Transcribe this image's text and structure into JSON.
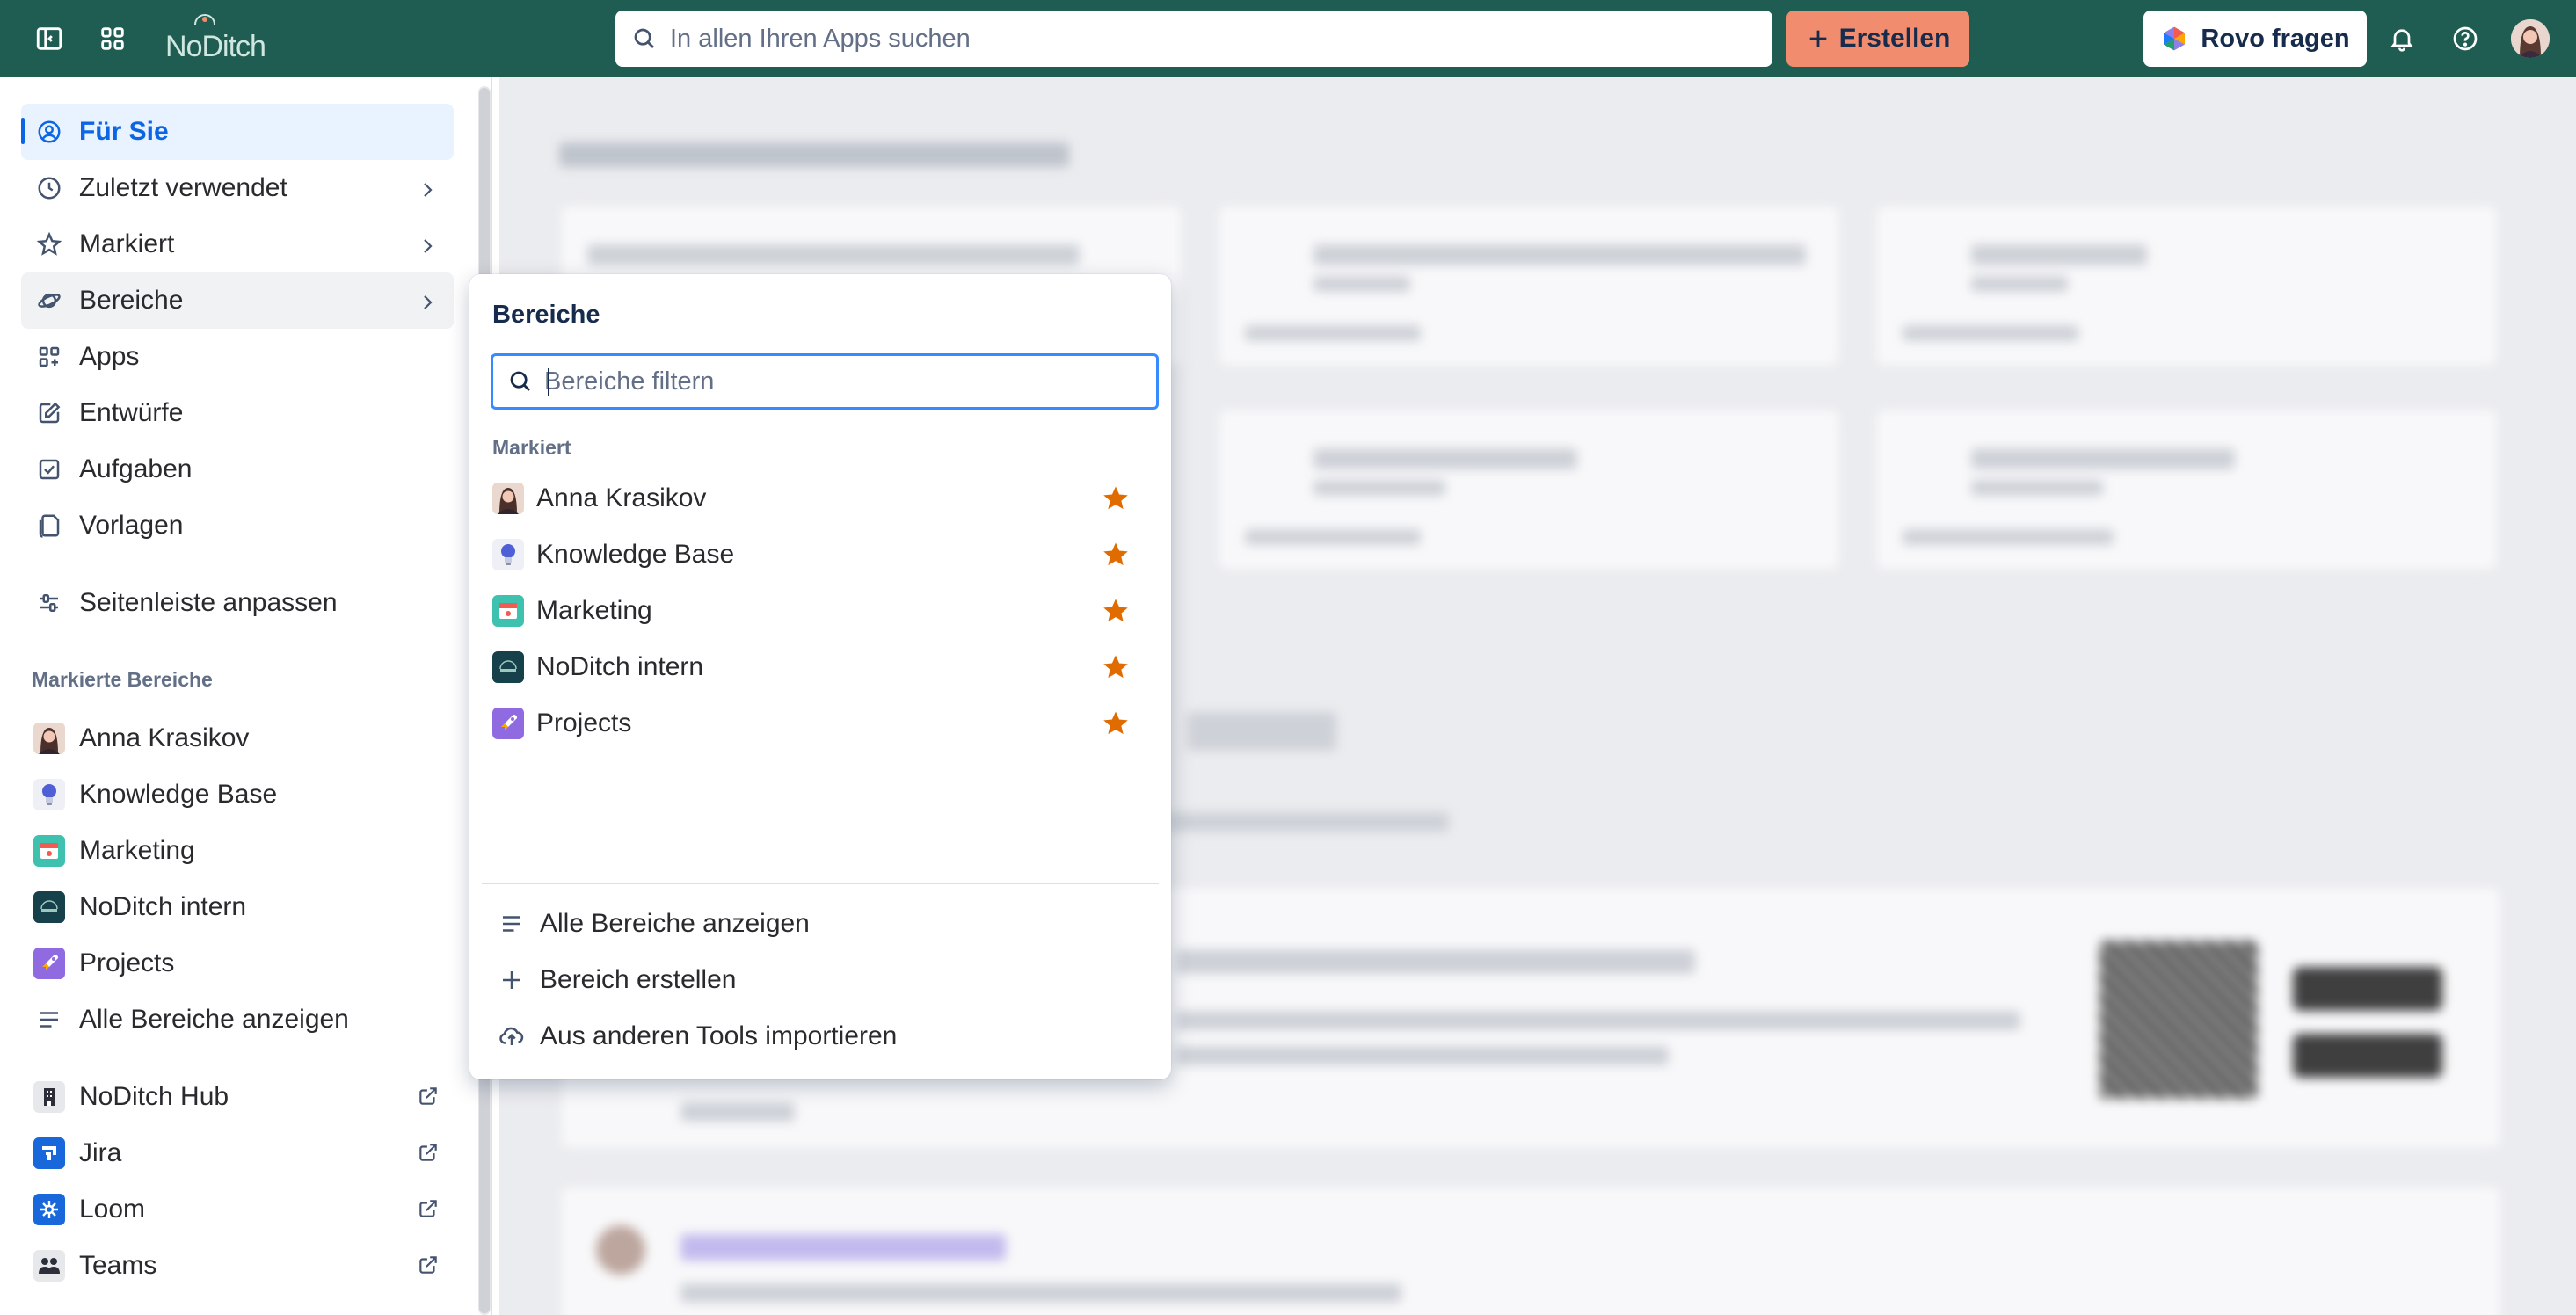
{
  "topbar": {
    "logo_text": "NoDitch",
    "search_placeholder": "In allen Ihren Apps suchen",
    "create_label": "Erstellen",
    "rovo_label": "Rovo fragen"
  },
  "sidebar": {
    "nav": [
      {
        "label": "Für Sie",
        "icon": "user-circle-icon"
      },
      {
        "label": "Zuletzt verwendet",
        "icon": "clock-icon"
      },
      {
        "label": "Markiert",
        "icon": "star-icon"
      },
      {
        "label": "Bereiche",
        "icon": "planet-icon"
      },
      {
        "label": "Apps",
        "icon": "apps-icon"
      },
      {
        "label": "Entwürfe",
        "icon": "edit-icon"
      },
      {
        "label": "Aufgaben",
        "icon": "checkbox-icon"
      },
      {
        "label": "Vorlagen",
        "icon": "template-icon"
      }
    ],
    "customize_label": "Seitenleiste anpassen",
    "starred_heading": "Markierte Bereiche",
    "spaces": [
      {
        "label": "Anna Krasikov"
      },
      {
        "label": "Knowledge Base"
      },
      {
        "label": "Marketing"
      },
      {
        "label": "NoDitch intern"
      },
      {
        "label": "Projects"
      }
    ],
    "all_spaces_label": "Alle Bereiche anzeigen",
    "apps": [
      {
        "label": "NoDitch Hub"
      },
      {
        "label": "Jira"
      },
      {
        "label": "Loom"
      },
      {
        "label": "Teams"
      }
    ]
  },
  "panel": {
    "title": "Bereiche",
    "filter_placeholder": "Bereiche filtern",
    "starred_label": "Markiert",
    "spaces": [
      {
        "label": "Anna Krasikov"
      },
      {
        "label": "Knowledge Base"
      },
      {
        "label": "Marketing"
      },
      {
        "label": "NoDitch intern"
      },
      {
        "label": "Projects"
      }
    ],
    "actions": [
      {
        "label": "Alle Bereiche anzeigen",
        "icon": "list-icon"
      },
      {
        "label": "Bereich erstellen",
        "icon": "plus-icon"
      },
      {
        "label": "Aus anderen Tools importieren",
        "icon": "cloud-upload-icon"
      }
    ]
  },
  "colors": {
    "topbar": "#1f5d52",
    "create": "#f18d6e",
    "accent": "#0c66e4",
    "star": "#e06c00",
    "focus": "#388bff"
  }
}
